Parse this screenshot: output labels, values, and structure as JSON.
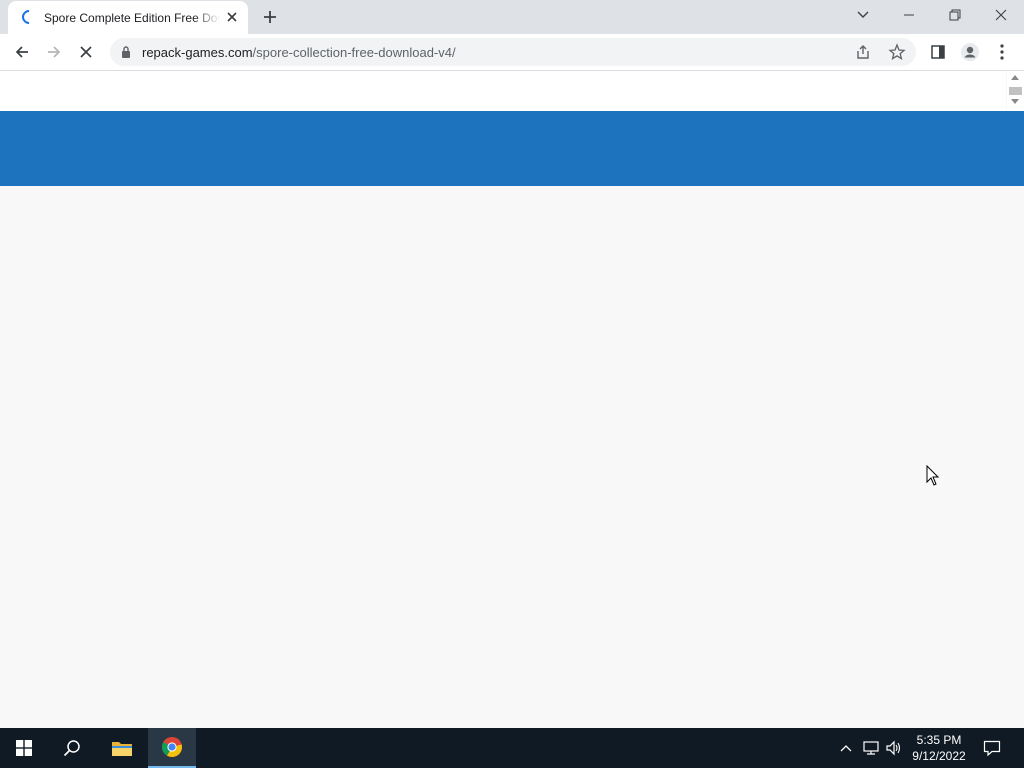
{
  "browser": {
    "tab": {
      "title": "Spore Complete Edition Free Download"
    },
    "omnibox": {
      "host": "repack-games.com",
      "path": "/spore-collection-free-download-v4/"
    }
  },
  "page": {
    "header_color": "#1e73be",
    "background_color": "#f8f8f8"
  },
  "taskbar": {
    "clock": {
      "time": "5:35 PM",
      "date": "9/12/2022"
    }
  }
}
